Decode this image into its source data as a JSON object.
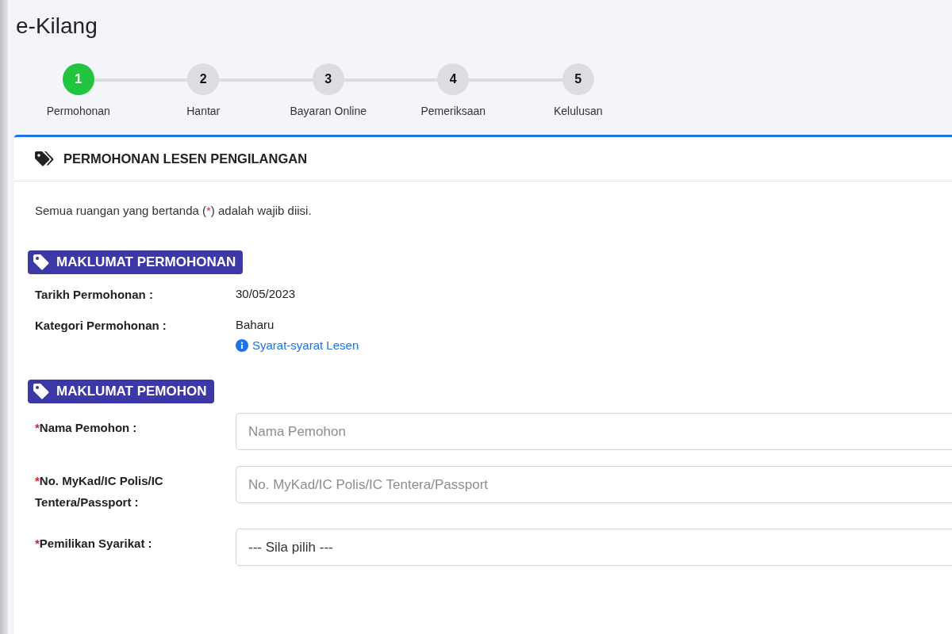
{
  "app_title": "e-Kilang",
  "steps": [
    {
      "number": "1",
      "label": "Permohonan",
      "selected": true
    },
    {
      "number": "2",
      "label": "Hantar",
      "selected": false
    },
    {
      "number": "3",
      "label": "Bayaran Online",
      "selected": false
    },
    {
      "number": "4",
      "label": "Pemeriksaan",
      "selected": false
    },
    {
      "number": "5",
      "label": "Kelulusan",
      "selected": false
    }
  ],
  "card": {
    "title": "PERMOHONAN LESEN PENGILANGAN",
    "notice": {
      "before": "Semua ruangan yang bertanda (",
      "mark": "*",
      "after": ") adalah wajib diisi."
    },
    "sections": [
      {
        "title": "MAKLUMAT PERMOHONAN",
        "rows": [
          {
            "kind": "info",
            "label": "Tarikh Permohonan :",
            "value": "30/05/2023"
          },
          {
            "kind": "info",
            "label": "Kategori Permohonan :",
            "value": "Baharu",
            "link": "Syarat-syarat Lesen"
          }
        ]
      },
      {
        "title": "MAKLUMAT PEMOHON",
        "rows": [
          {
            "kind": "input",
            "required_mark": "*",
            "label": "Nama Pemohon :",
            "placeholder": "Nama Pemohon"
          },
          {
            "kind": "input",
            "required_mark": "*",
            "label": "No. MyKad/IC Polis/IC Tentera/Passport :",
            "placeholder": "No. MyKad/IC Polis/IC Tentera/Passport"
          },
          {
            "kind": "select",
            "required_mark": "*",
            "label": "Pemilikan Syarikat :",
            "value": "--- Sila pilih ---"
          }
        ]
      }
    ]
  }
}
